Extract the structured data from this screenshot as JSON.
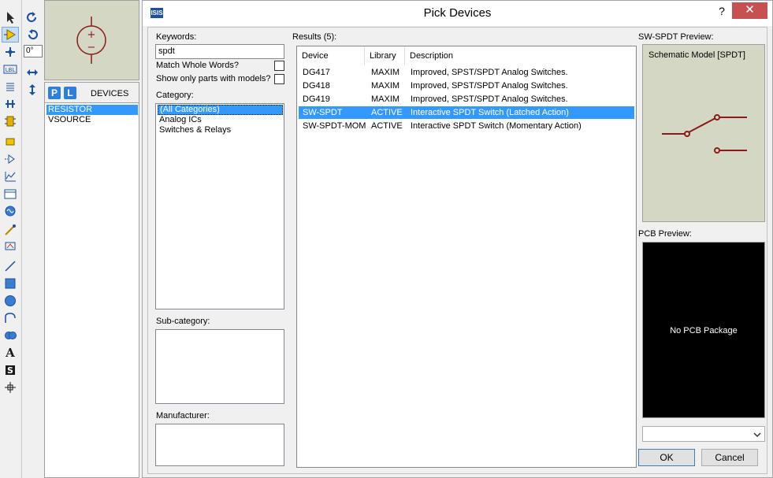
{
  "left_toolbar": {
    "icons": [
      "select-arrow-icon",
      "component-mode-icon",
      "junction-dot-icon",
      "wire-label-icon",
      "text-script-icon",
      "bus-icon",
      "subcircuit-icon",
      "terminal-icon",
      "pin-icon",
      "graph-icon",
      "tape-icon",
      "generator-icon",
      "voltage-probe-icon",
      "current-probe-icon",
      "line-icon",
      "box-icon",
      "circle-icon",
      "arc-icon",
      "path-icon",
      "text-icon",
      "symbol-icon",
      "marker-icon"
    ]
  },
  "rotation_toolbar": {
    "angle_value": "0°",
    "icons": [
      "rotate-cw-icon",
      "rotate-ccw-icon",
      "mirror-horizontal-icon",
      "mirror-vertical-icon"
    ]
  },
  "device_panel": {
    "p_button": "P",
    "l_button": "L",
    "title": "DEVICES",
    "items": [
      {
        "label": "RESISTOR",
        "selected": true
      },
      {
        "label": "VSOURCE",
        "selected": false
      }
    ]
  },
  "dialog": {
    "title": "Pick Devices",
    "help_label": "?",
    "close_label": "✕",
    "app_icon_text": "ISIS",
    "keywords_label": "Keywords:",
    "keywords_value": "spdt",
    "match_whole_words_label": "Match Whole Words?",
    "match_whole_words_checked": false,
    "show_only_models_label": "Show only parts with models?",
    "show_only_models_checked": false,
    "category_label": "Category:",
    "categories": [
      {
        "label": "(All Categories)",
        "selected": true
      },
      {
        "label": "Analog ICs",
        "selected": false
      },
      {
        "label": "Switches & Relays",
        "selected": false
      }
    ],
    "subcategory_label": "Sub-category:",
    "manufacturer_label": "Manufacturer:",
    "results_label": "Results (5):",
    "columns": [
      "Device",
      "Library",
      "Description"
    ],
    "results": [
      {
        "device": "DG417",
        "library": "MAXIM",
        "description": "Improved, SPST/SPDT Analog Switches.",
        "selected": false
      },
      {
        "device": "DG418",
        "library": "MAXIM",
        "description": "Improved, SPST/SPDT Analog Switches.",
        "selected": false
      },
      {
        "device": "DG419",
        "library": "MAXIM",
        "description": "Improved, SPST/SPDT Analog Switches.",
        "selected": false
      },
      {
        "device": "SW-SPDT",
        "library": "ACTIVE",
        "description": "Interactive SPDT Switch (Latched Action)",
        "selected": true
      },
      {
        "device": "SW-SPDT-MOM",
        "library": "ACTIVE",
        "description": "Interactive SPDT Switch (Momentary Action)",
        "selected": false
      }
    ],
    "preview_label": "SW-SPDT Preview:",
    "schematic_model": "Schematic Model [SPDT]",
    "pcb_preview_label": "PCB Preview:",
    "pcb_message": "No PCB Package",
    "pcb_select_value": "",
    "ok_label": "OK",
    "cancel_label": "Cancel"
  },
  "colors": {
    "selection": "#3399ff",
    "close_button": "#c75050",
    "symbol_red": "#8b1a1a",
    "preview_bg": "#d4d7c4"
  }
}
